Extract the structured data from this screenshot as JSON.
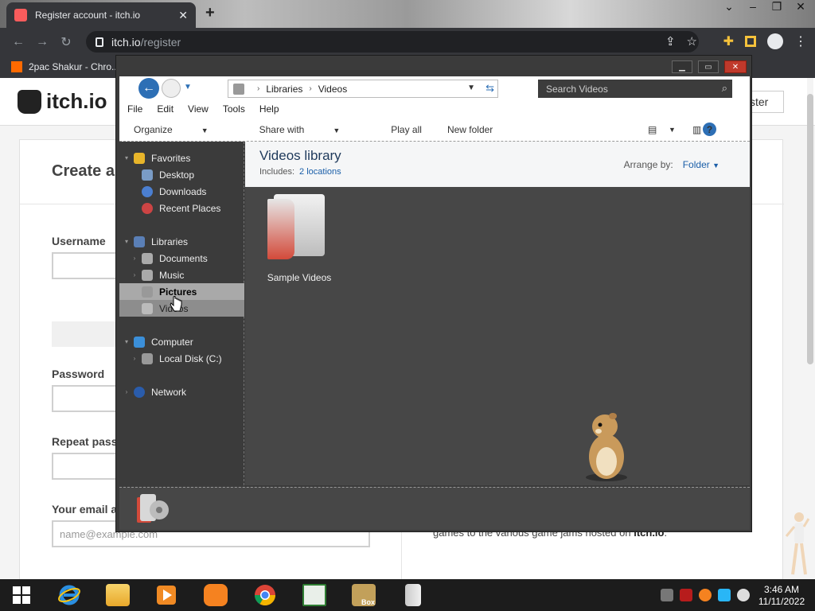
{
  "browser": {
    "tab_title": "Register account - itch.io",
    "tab_close": "✕",
    "new_tab": "+",
    "window_controls": [
      "⌄",
      "–",
      "❐",
      "✕"
    ],
    "url_host": "itch.io",
    "url_path": "/register",
    "bookmark": "2pac Shakur - Chro..."
  },
  "site": {
    "logo_text": "itch.io",
    "register_btn": "ster",
    "form_title": "Create ar",
    "username_label": "Username",
    "password_label": "Password",
    "repeat_label": "Repeat passw",
    "email_label": "Your email ac",
    "email_placeholder": "name@example.com",
    "side_text_pre": "games to the various game jams hosted on ",
    "side_text_link": "itch.io"
  },
  "explorer": {
    "address": {
      "root": "Libraries",
      "current": "Videos"
    },
    "search_placeholder": "Search Videos",
    "menu": [
      "File",
      "Edit",
      "View",
      "Tools",
      "Help"
    ],
    "commands": {
      "organize": "Organize",
      "share": "Share with",
      "play": "Play all",
      "new_folder": "New folder"
    },
    "help": "?",
    "nav": {
      "favorites": "Favorites",
      "desktop": "Desktop",
      "downloads": "Downloads",
      "recent": "Recent Places",
      "libraries": "Libraries",
      "documents": "Documents",
      "music": "Music",
      "pictures": "Pictures",
      "videos": "Videos",
      "computer": "Computer",
      "local_disk": "Local Disk (C:)",
      "network": "Network"
    },
    "library": {
      "title": "Videos library",
      "includes_label": "Includes:",
      "locations": "2 locations",
      "arrange_label": "Arrange by:",
      "arrange_value": "Folder"
    },
    "items": [
      {
        "label": "Sample Videos"
      }
    ]
  },
  "taskbar": {
    "time": "3:46 AM",
    "date": "11/11/2022",
    "box_label": "Box"
  },
  "colors": {
    "explorer_dark": "#3b3b3b",
    "accent_blue": "#1a5ea8",
    "taskbar": "#1c1c1c"
  }
}
